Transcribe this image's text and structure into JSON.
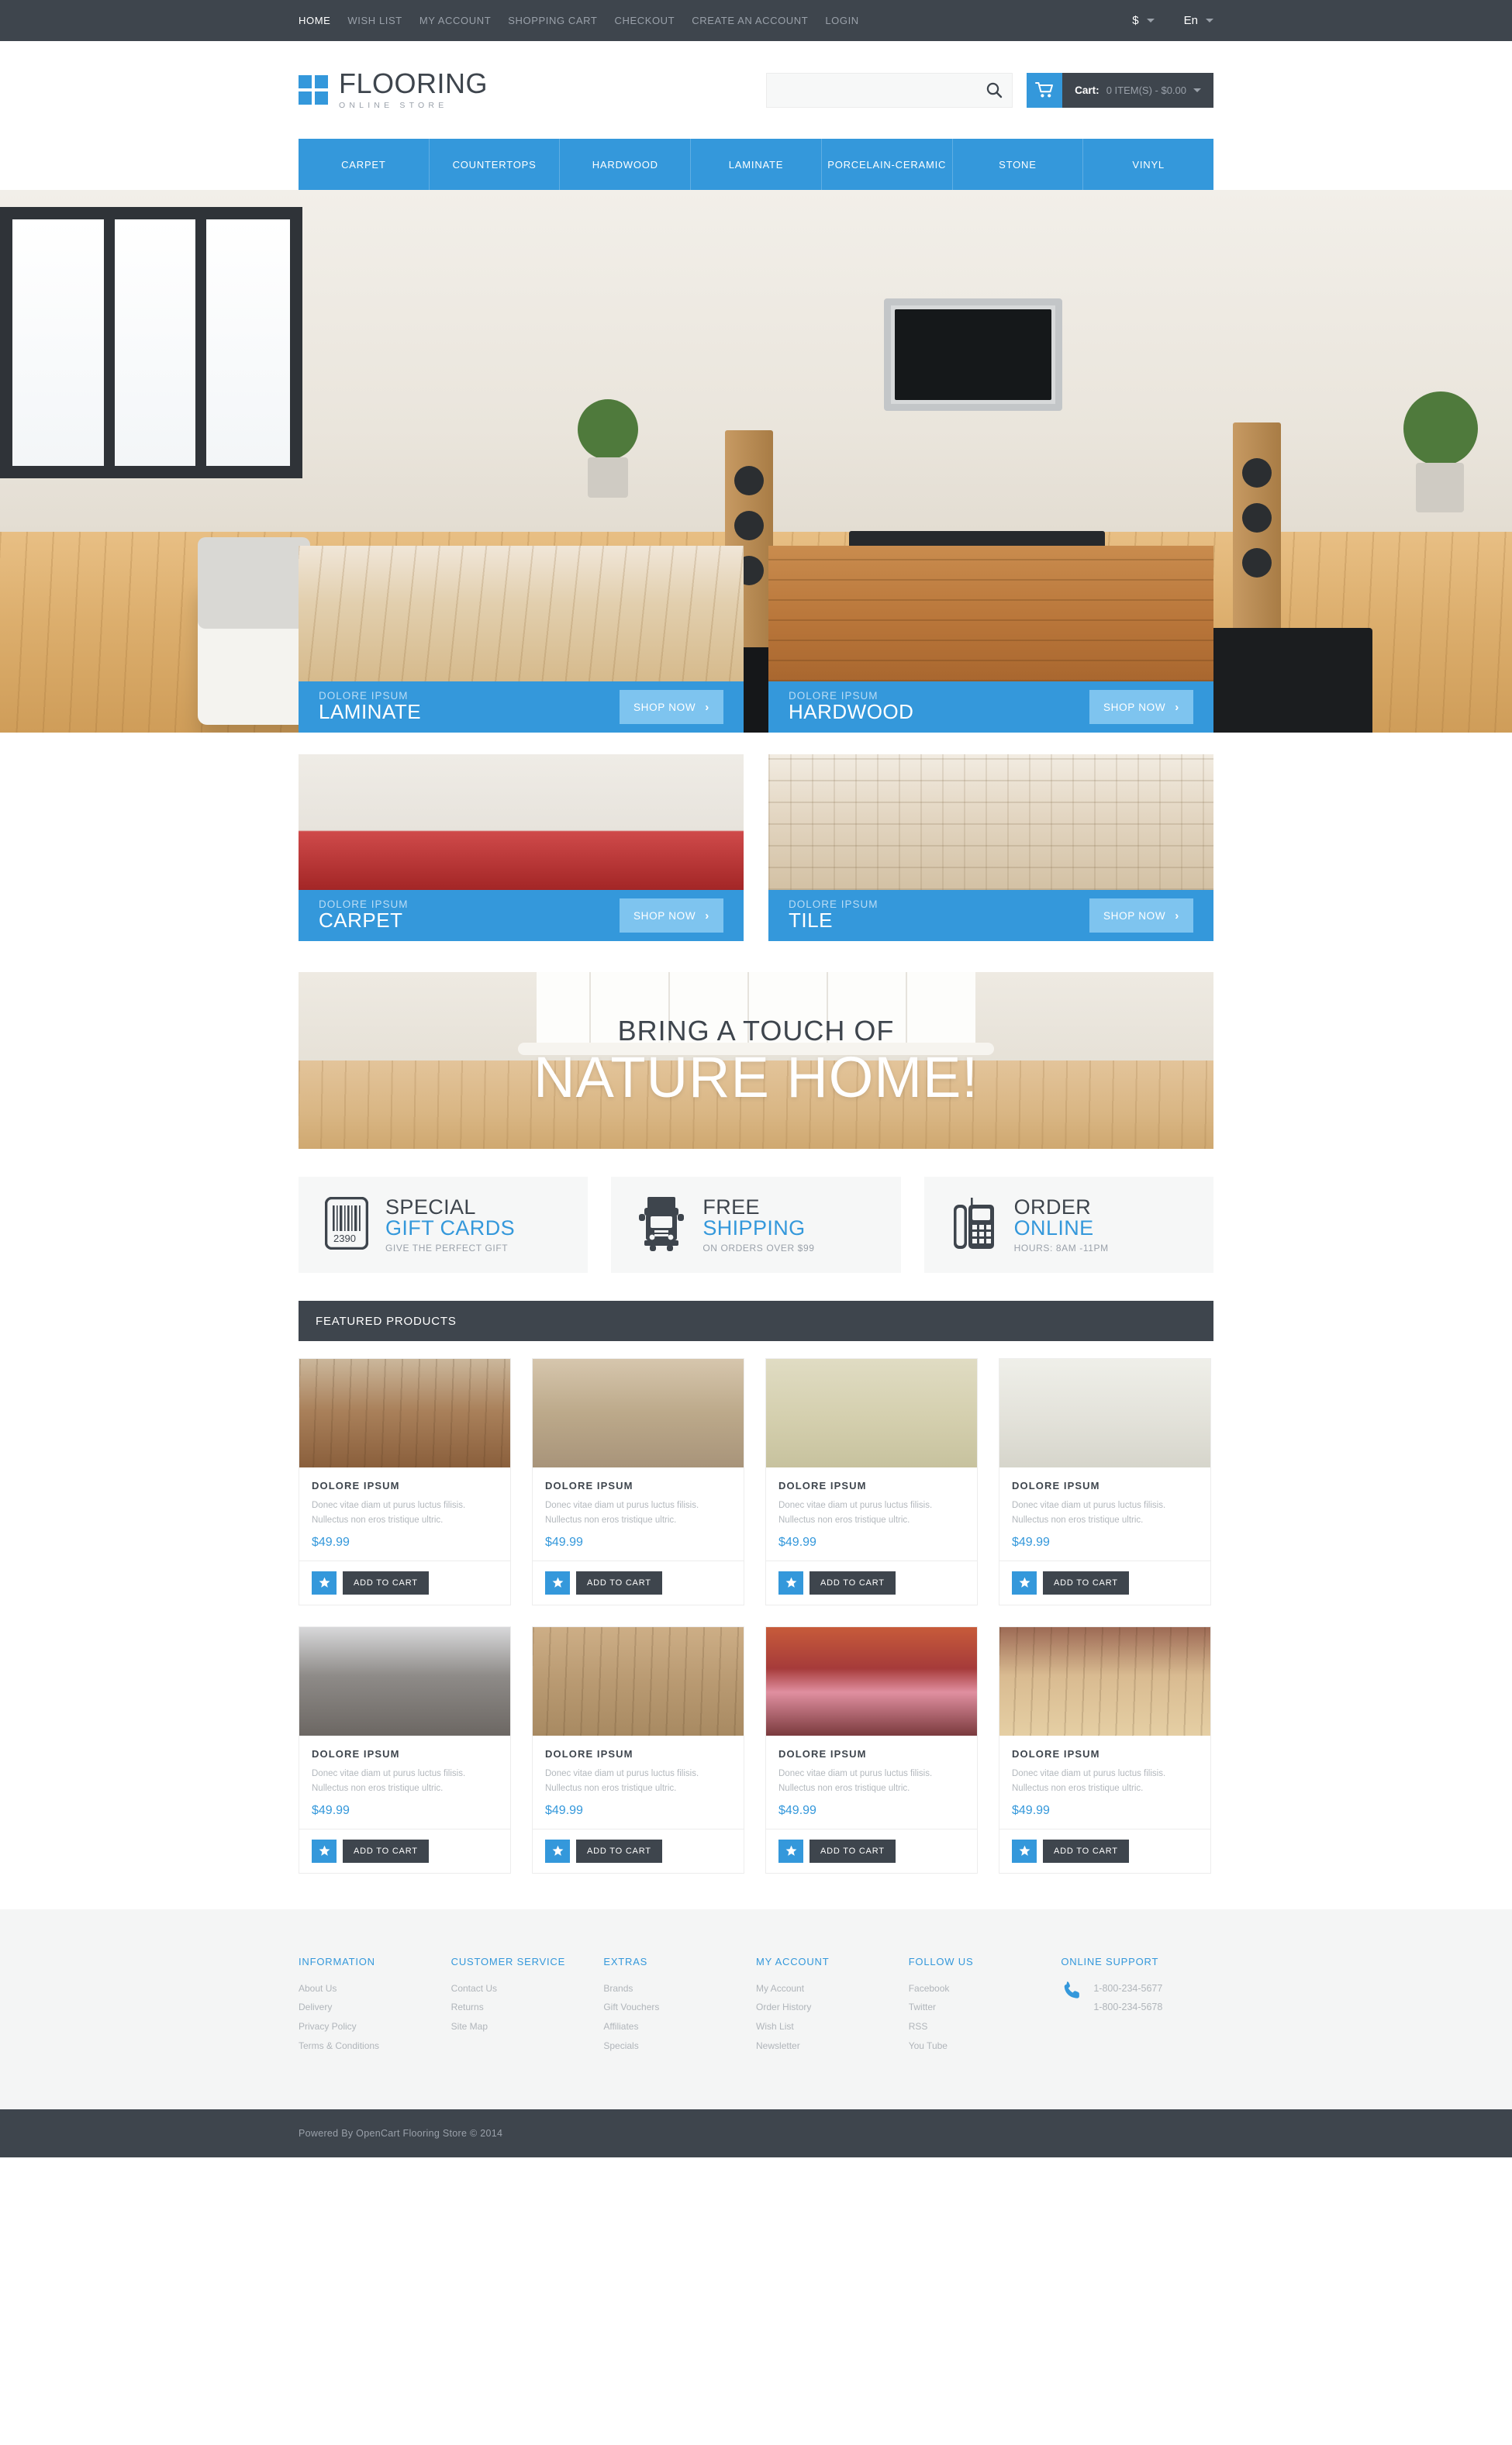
{
  "topbar": {
    "links": [
      {
        "label": "HOME",
        "active": true
      },
      {
        "label": "WISH LIST",
        "active": false
      },
      {
        "label": "MY ACCOUNT",
        "active": false
      },
      {
        "label": "SHOPPING CART",
        "active": false
      },
      {
        "label": "CHECKOUT",
        "active": false
      },
      {
        "label": "CREATE AN ACCOUNT",
        "active": false
      },
      {
        "label": "LOGIN",
        "active": false
      }
    ],
    "currency": "$",
    "language": "En"
  },
  "header": {
    "logo_title": "FLOORING",
    "logo_subtitle": "ONLINE STORE",
    "search_placeholder": "",
    "search_value": "",
    "search_icon": "search-icon",
    "cart_icon": "shopping-cart-icon",
    "cart_label": "Cart:",
    "cart_summary": "0 ITEM(S) - $0.00"
  },
  "nav": {
    "items": [
      {
        "label": "CARPET"
      },
      {
        "label": "COUNTERTOPS"
      },
      {
        "label": "HARDWOOD"
      },
      {
        "label": "LAMINATE"
      },
      {
        "label": "PORCELAIN-CERAMIC"
      },
      {
        "label": "STONE"
      },
      {
        "label": "VINYL"
      }
    ]
  },
  "category_cards": [
    {
      "eyebrow": "DOLORE IPSUM",
      "title": "LAMINATE",
      "cta": "SHOP NOW",
      "chevron": "›"
    },
    {
      "eyebrow": "DOLORE IPSUM",
      "title": "HARDWOOD",
      "cta": "SHOP NOW",
      "chevron": "›"
    },
    {
      "eyebrow": "DOLORE IPSUM",
      "title": "CARPET",
      "cta": "SHOP NOW",
      "chevron": "›"
    },
    {
      "eyebrow": "DOLORE IPSUM",
      "title": "TILE",
      "cta": "SHOP NOW",
      "chevron": "›"
    }
  ],
  "promo": {
    "line1": "BRING A TOUCH OF",
    "line2": "NATURE HOME!"
  },
  "services": [
    {
      "icon": "barcode-icon",
      "barcode_number": "2390",
      "title1": "SPECIAL",
      "title2": "GIFT CARDS",
      "subtitle": "GIVE THE PERFECT GIFT"
    },
    {
      "icon": "truck-icon",
      "title1": "FREE",
      "title2": "SHIPPING",
      "subtitle": "ON ORDERS OVER $99"
    },
    {
      "icon": "telephone-icon",
      "title1": "ORDER",
      "title2": "ONLINE",
      "subtitle": "HOURS: 8AM -11PM"
    }
  ],
  "featured": {
    "heading": "FEATURED PRODUCTS",
    "products": [
      {
        "title": "DOLORE IPSUM",
        "desc": "Donec vitae diam ut purus luctus filisis. Nullectus non eros tristique ultric.",
        "price": "$49.99",
        "wish_icon": "star-icon",
        "cart_label": "ADD TO CART"
      },
      {
        "title": "DOLORE IPSUM",
        "desc": "Donec vitae diam ut purus luctus filisis. Nullectus non eros tristique ultric.",
        "price": "$49.99",
        "wish_icon": "star-icon",
        "cart_label": "ADD TO CART"
      },
      {
        "title": "DOLORE IPSUM",
        "desc": "Donec vitae diam ut purus luctus filisis. Nullectus non eros tristique ultric.",
        "price": "$49.99",
        "wish_icon": "star-icon",
        "cart_label": "ADD TO CART"
      },
      {
        "title": "DOLORE IPSUM",
        "desc": "Donec vitae diam ut purus luctus filisis. Nullectus non eros tristique ultric.",
        "price": "$49.99",
        "wish_icon": "star-icon",
        "cart_label": "ADD TO CART"
      },
      {
        "title": "DOLORE IPSUM",
        "desc": "Donec vitae diam ut purus luctus filisis. Nullectus non eros tristique ultric.",
        "price": "$49.99",
        "wish_icon": "star-icon",
        "cart_label": "ADD TO CART"
      },
      {
        "title": "DOLORE IPSUM",
        "desc": "Donec vitae diam ut purus luctus filisis. Nullectus non eros tristique ultric.",
        "price": "$49.99",
        "wish_icon": "star-icon",
        "cart_label": "ADD TO CART"
      },
      {
        "title": "DOLORE IPSUM",
        "desc": "Donec vitae diam ut purus luctus filisis. Nullectus non eros tristique ultric.",
        "price": "$49.99",
        "wish_icon": "star-icon",
        "cart_label": "ADD TO CART"
      },
      {
        "title": "DOLORE IPSUM",
        "desc": "Donec vitae diam ut purus luctus filisis. Nullectus non eros tristique ultric.",
        "price": "$49.99",
        "wish_icon": "star-icon",
        "cart_label": "ADD TO CART"
      }
    ]
  },
  "footer": {
    "columns": [
      {
        "heading": "INFORMATION",
        "links": [
          "About Us",
          "Delivery",
          "Privacy Policy",
          "Terms & Conditions"
        ]
      },
      {
        "heading": "CUSTOMER SERVICE",
        "links": [
          "Contact Us",
          "Returns",
          "Site Map"
        ]
      },
      {
        "heading": "EXTRAS",
        "links": [
          "Brands",
          "Gift Vouchers",
          "Affiliates",
          "Specials"
        ]
      },
      {
        "heading": "MY ACCOUNT",
        "links": [
          "My Account",
          "Order History",
          "Wish List",
          "Newsletter"
        ]
      },
      {
        "heading": "FOLLOW US",
        "links": [
          "Facebook",
          "Twitter",
          "RSS",
          "You Tube"
        ]
      }
    ],
    "support": {
      "heading": "ONLINE SUPPORT",
      "icon": "phone-icon",
      "phones": [
        "1-800-234-5677",
        "1-800-234-5678"
      ]
    },
    "copyright": "Powered By OpenCart Flooring Store © 2014"
  },
  "colors": {
    "accent": "#3498db",
    "accent_light": "#7ec4ef",
    "dark": "#3e454d",
    "muted": "#9aa1aa",
    "footer_bg": "#f4f5f5"
  }
}
